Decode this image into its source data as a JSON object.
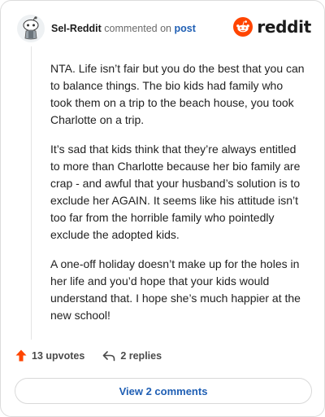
{
  "comment": {
    "username": "Sel-Reddit",
    "action": "commented on",
    "target": "post",
    "paragraphs": [
      "NTA. Life isn’t fair but you do the best that you can to balance things. The bio kids had family who took them on a trip to the beach house, you took Charlotte on a trip.",
      "It’s sad that kids think that they’re always entitled to more than Charlotte because her bio family are crap - and awful that your husband’s solution is to exclude her AGAIN. It seems like his attitude isn’t too far from the horrible family who pointedly exclude the adopted kids.",
      "A one-off holiday doesn’t make up for the holes in her life and you’d hope that your kids would understand that. I hope she’s much happier at the new school!"
    ]
  },
  "brand": {
    "wordmark": "reddit",
    "icon": "reddit-snoo-icon",
    "color": "#ff4500"
  },
  "footer": {
    "upvotes": "13 upvotes",
    "replies": "2 replies",
    "upvote_color": "#ff4500"
  },
  "view_button": {
    "label": "View 2 comments",
    "color": "#1f5fb4"
  }
}
